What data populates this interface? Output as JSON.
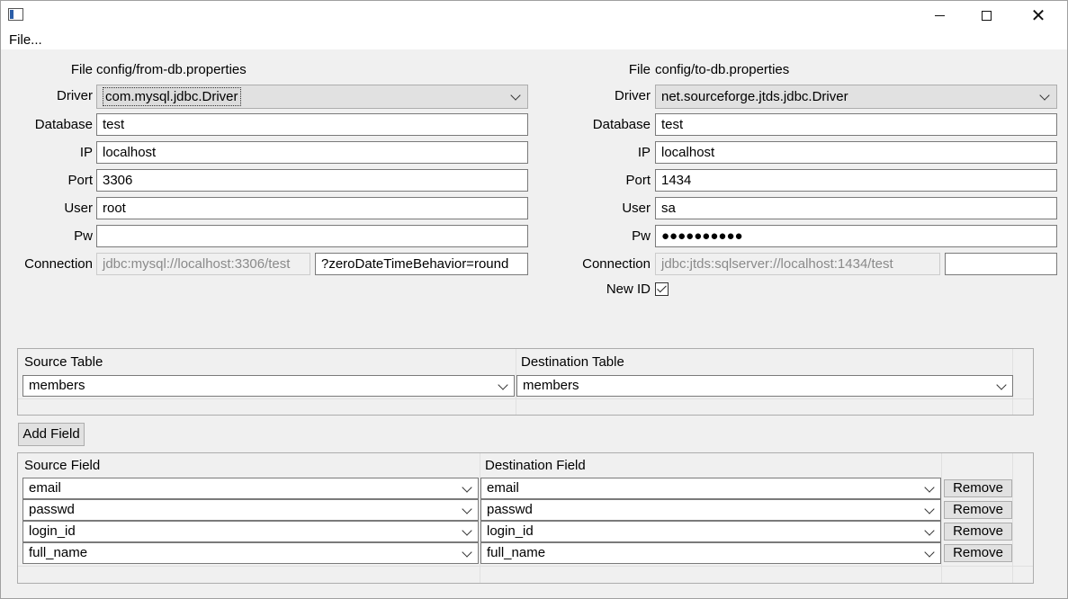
{
  "menu": {
    "file": "File..."
  },
  "from": {
    "file_label": "File",
    "file_value": "config/from-db.properties",
    "driver_label": "Driver",
    "driver_value": "com.mysql.jdbc.Driver",
    "database_label": "Database",
    "database_value": "test",
    "ip_label": "IP",
    "ip_value": "localhost",
    "port_label": "Port",
    "port_value": "3306",
    "user_label": "User",
    "user_value": "root",
    "pw_label": "Pw",
    "pw_value": "",
    "connection_label": "Connection",
    "connection_value": "jdbc:mysql://localhost:3306/test",
    "connection_params": "?zeroDateTimeBehavior=round"
  },
  "to": {
    "file_label": "File",
    "file_value": "config/to-db.properties",
    "driver_label": "Driver",
    "driver_value": "net.sourceforge.jtds.jdbc.Driver",
    "database_label": "Database",
    "database_value": "test",
    "ip_label": "IP",
    "ip_value": "localhost",
    "port_label": "Port",
    "port_value": "1434",
    "user_label": "User",
    "user_value": "sa",
    "pw_label": "Pw",
    "pw_value": "●●●●●●●●●●",
    "connection_label": "Connection",
    "connection_value": "jdbc:jtds:sqlserver://localhost:1434/test",
    "connection_params": "",
    "new_id_label": "New ID",
    "new_id_checked": true
  },
  "tables": {
    "source_header": "Source Table",
    "destination_header": "Destination Table",
    "source_value": "members",
    "destination_value": "members"
  },
  "add_field_label": "Add Field",
  "fields": {
    "source_header": "Source Field",
    "destination_header": "Destination Field",
    "remove_label": "Remove",
    "rows": [
      {
        "source": "email",
        "destination": "email"
      },
      {
        "source": "passwd",
        "destination": "passwd"
      },
      {
        "source": "login_id",
        "destination": "login_id"
      },
      {
        "source": "full_name",
        "destination": "full_name"
      }
    ]
  },
  "icons": {
    "app": "window-icon",
    "minimize": "minimize-icon",
    "maximize": "maximize-icon",
    "close": "close-icon",
    "dropdown": "chevron-down-icon",
    "checkbox": "checkmark-icon"
  }
}
